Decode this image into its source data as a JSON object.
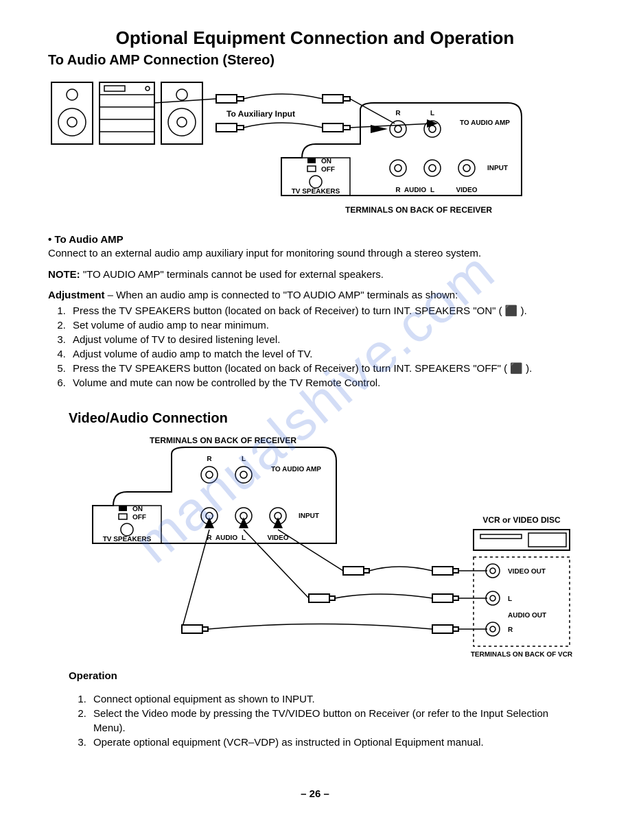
{
  "title": "Optional Equipment Connection and Operation",
  "section1": {
    "heading": "To Audio AMP Connection (Stereo)",
    "diagram": {
      "aux_label": "To Auxiliary Input",
      "on": "ON",
      "off": "OFF",
      "tv_speakers": "TV SPEAKERS",
      "r": "R",
      "l": "L",
      "to_audio_amp": "TO AUDIO AMP",
      "input": "INPUT",
      "audio": "AUDIO",
      "video": "VIDEO",
      "caption": "TERMINALS ON BACK OF RECEIVER"
    },
    "bullet_heading": "To Audio AMP",
    "para1": "Connect to an external audio amp auxiliary input for monitoring sound through a stereo system.",
    "note_label": "NOTE:",
    "note_text": " \"TO AUDIO AMP\" terminals cannot be used for external speakers.",
    "adj_label": "Adjustment",
    "adj_text": " – When an audio amp is connected to \"TO AUDIO AMP\" terminals as shown:",
    "steps": [
      "Press the TV SPEAKERS button (located on back of Receiver) to turn INT. SPEAKERS \"ON\" ( ⬛ ).",
      "Set volume of audio amp to near minimum.",
      "Adjust volume of TV to desired listening level.",
      "Adjust volume of audio amp to match the level of TV.",
      "Press the TV SPEAKERS button (located on back of Receiver) to turn INT. SPEAKERS \"OFF\" ( ⬛ ).",
      "Volume and mute can now be controlled by the TV Remote Control."
    ]
  },
  "section2": {
    "heading": "Video/Audio Connection",
    "diagram": {
      "caption_top": "TERMINALS ON BACK OF RECEIVER",
      "on": "ON",
      "off": "OFF",
      "tv_speakers": "TV SPEAKERS",
      "r": "R",
      "l": "L",
      "to_audio_amp": "TO AUDIO AMP",
      "input": "INPUT",
      "audio": "AUDIO",
      "video": "VIDEO",
      "vcr_title": "VCR or VIDEO DISC",
      "video_out": "VIDEO OUT",
      "audio_out": "AUDIO OUT",
      "port_l": "L",
      "port_r": "R",
      "caption_bottom": "TERMINALS ON BACK OF VCR"
    },
    "op_heading": "Operation",
    "steps": [
      "Connect optional equipment as shown to INPUT.",
      "Select the Video mode by pressing the TV/VIDEO button on Receiver (or refer to the Input Selection Menu).",
      "Operate optional equipment (VCR–VDP) as instructed in Optional Equipment manual."
    ]
  },
  "page_number": "– 26 –",
  "watermark": "manualshive.com"
}
